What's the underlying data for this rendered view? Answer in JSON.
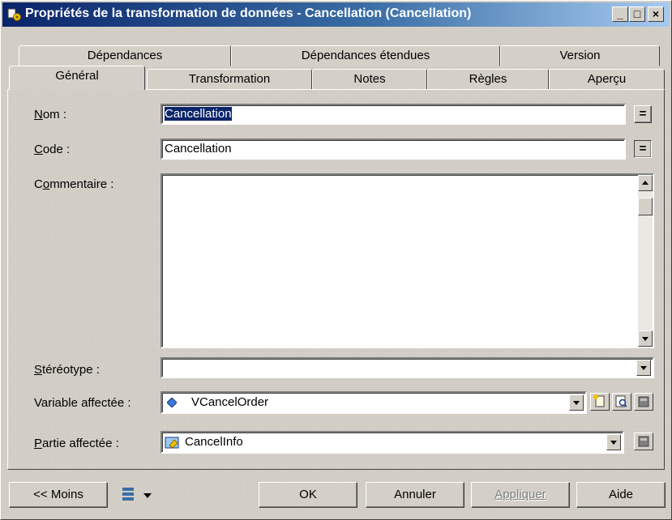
{
  "window": {
    "title": "Propriétés de la transformation de données - Cancellation (Cancellation)",
    "min_label": "_",
    "max_label": "□",
    "close_label": "×"
  },
  "tabs": {
    "row_back": [
      "Dépendances",
      "Dépendances étendues",
      "Version"
    ],
    "row_front": [
      "Général",
      "Transformation",
      "Notes",
      "Règles",
      "Aperçu"
    ],
    "active": "Général"
  },
  "form": {
    "name_label_u": "N",
    "name_label_rest": "om :",
    "name_value": "Cancellation",
    "code_label_u": "C",
    "code_label_rest": "ode :",
    "code_value": "Cancellation",
    "comment_label_pre": "C",
    "comment_label_u": "o",
    "comment_label_rest": "mmentaire :",
    "comment_value": "",
    "stereotype_label_u": "S",
    "stereotype_label_rest": "téréotype :",
    "stereotype_value": "",
    "variable_label": "Variable affectée :",
    "variable_value": "VCancelOrder",
    "partie_label_u": "P",
    "partie_label_rest": "artie affectée :",
    "partie_value": "CancelInfo",
    "equals_label": "="
  },
  "buttons": {
    "less": "<< Moins",
    "ok": "OK",
    "cancel": "Annuler",
    "apply": "Appliquer",
    "help": "Aide"
  },
  "icons": {
    "app": "properties-gear-icon",
    "variable": "variable-diamond-icon",
    "partie": "folder-part-icon"
  },
  "colors": {
    "title_start": "#0a246a",
    "title_end": "#a6caf0",
    "selection": "#0a246a",
    "face": "#d4d0c8"
  }
}
